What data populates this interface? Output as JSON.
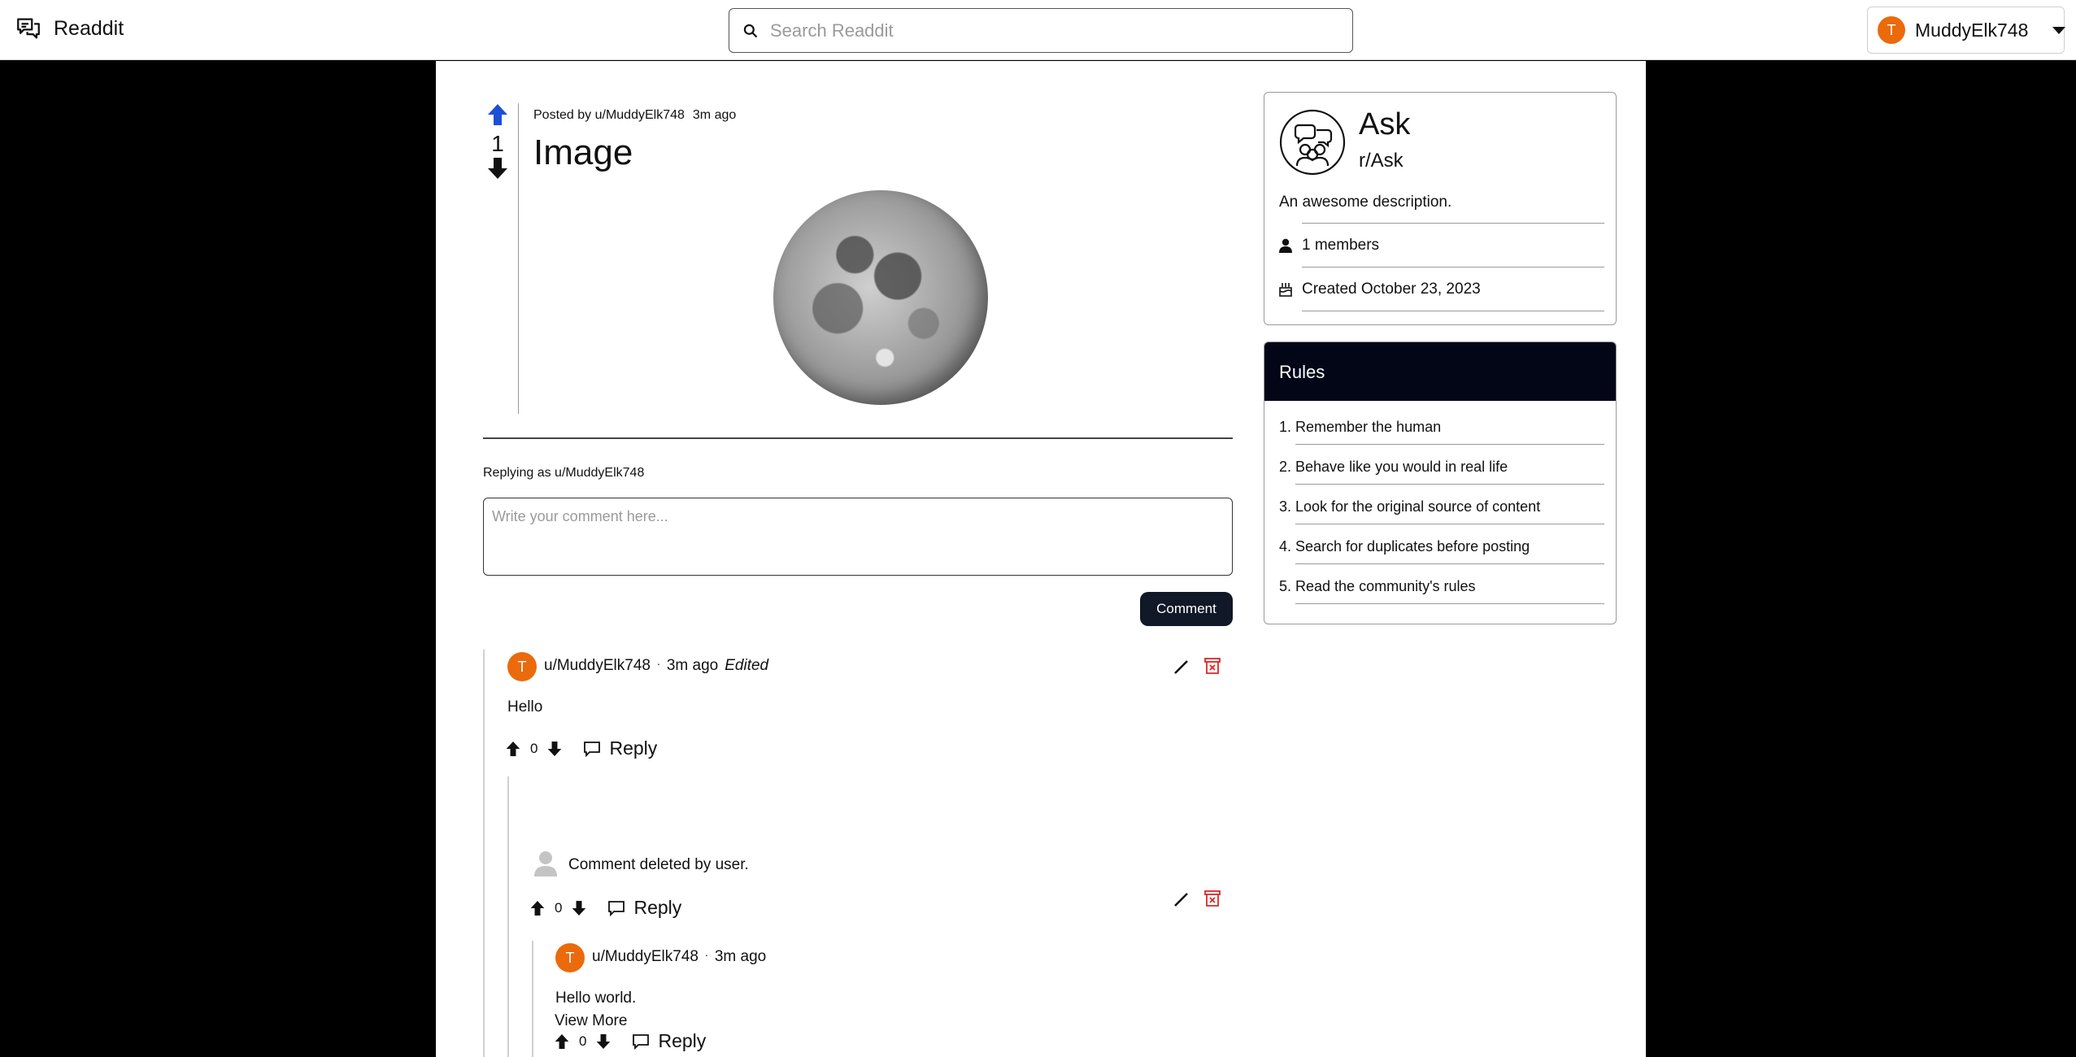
{
  "header": {
    "brand": "Readdit",
    "search_placeholder": "Search Readdit",
    "user": {
      "avatar_letter": "T",
      "name": "MuddyElk748"
    }
  },
  "post": {
    "meta_author": "Posted by u/MuddyElk748",
    "meta_time": "3m ago",
    "title": "Image",
    "votes": "1"
  },
  "composer": {
    "replying_as": "Replying as u/MuddyElk748",
    "placeholder": "Write your comment here...",
    "submit_label": "Comment"
  },
  "comments": [
    {
      "avatar_letter": "T",
      "author": "u/MuddyElk748",
      "time": "3m ago",
      "edited": "Edited",
      "body": "Hello",
      "votes": "0",
      "reply_label": "Reply"
    },
    {
      "body": "Comment deleted by user.",
      "votes": "0",
      "reply_label": "Reply"
    },
    {
      "avatar_letter": "T",
      "author": "u/MuddyElk748",
      "time": "3m ago",
      "body": "Hello world.",
      "votes": "0",
      "reply_label": "Reply"
    }
  ],
  "view_more": "View More",
  "community": {
    "name": "Ask",
    "slug": "r/Ask",
    "description": "An awesome description.",
    "members": "1 members",
    "created": "Created October 23, 2023"
  },
  "rules": {
    "title": "Rules",
    "items": [
      "1. Remember the human",
      "2. Behave like you would in real life",
      "3. Look for the original source of content",
      "4. Search for duplicates before posting",
      "5. Read the community's rules"
    ]
  },
  "colors": {
    "accent_avatar": "#ea6a0c",
    "upvote_active": "#1d4ed8",
    "delete_icon": "#dc2626",
    "button_dark": "#111827",
    "rules_header": "#020617"
  }
}
